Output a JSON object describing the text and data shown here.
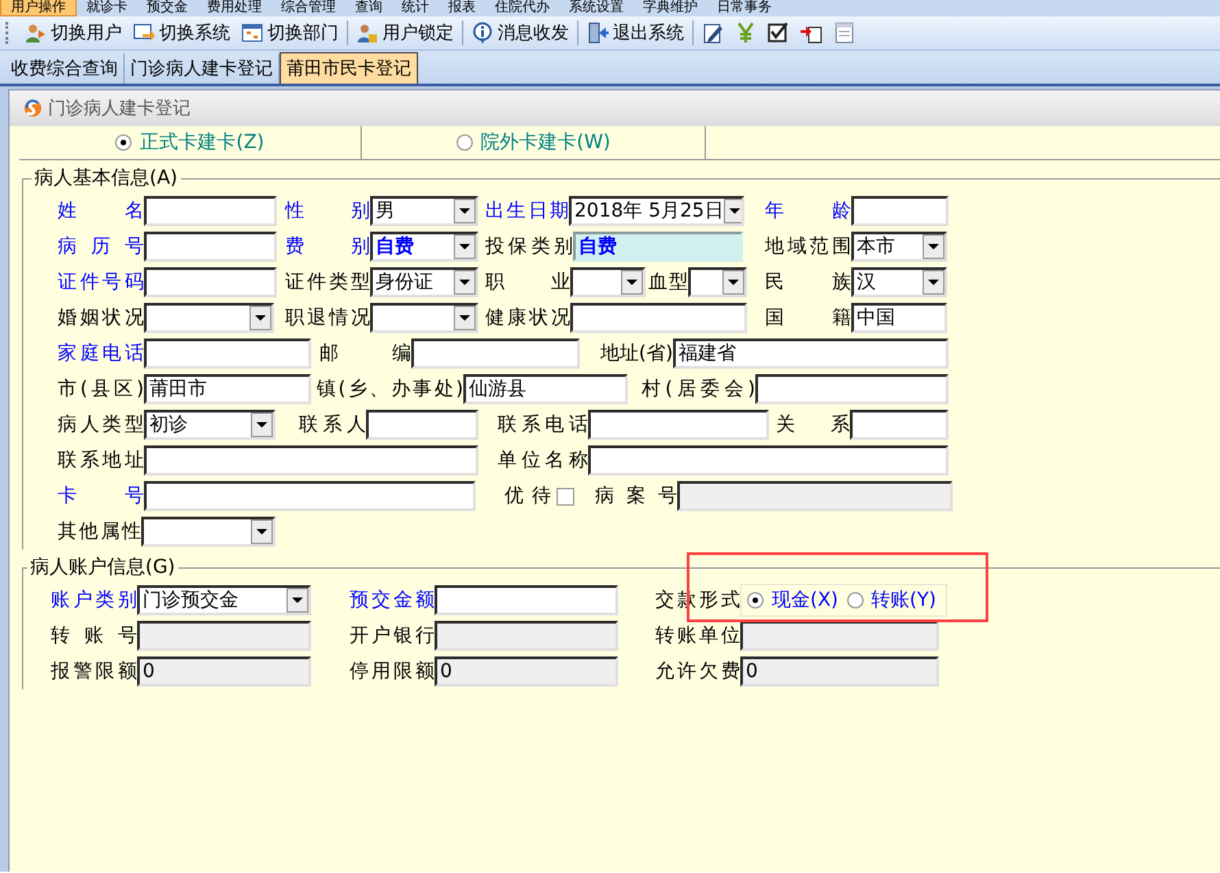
{
  "menu_bar": [
    {
      "label": "用户操作",
      "selected": true
    },
    {
      "label": "就诊卡",
      "selected": false
    },
    {
      "label": "预交金",
      "selected": false
    },
    {
      "label": "费用处理",
      "selected": false
    },
    {
      "label": "综合管理",
      "selected": false
    },
    {
      "label": "查询",
      "selected": false
    },
    {
      "label": "统计",
      "selected": false
    },
    {
      "label": "报表",
      "selected": false
    },
    {
      "label": "住院代办",
      "selected": false
    },
    {
      "label": "系统设置",
      "selected": false
    },
    {
      "label": "字典维护",
      "selected": false
    },
    {
      "label": "日常事务",
      "selected": false
    }
  ],
  "toolbar": [
    {
      "kind": "users",
      "label": "切换用户"
    },
    {
      "kind": "switch",
      "label": "切换系统"
    },
    {
      "kind": "dept",
      "label": "切换部门"
    },
    {
      "kind": "sep"
    },
    {
      "kind": "lock",
      "label": "用户锁定"
    },
    {
      "kind": "sep"
    },
    {
      "kind": "info",
      "label": "消息收发"
    },
    {
      "kind": "sep"
    },
    {
      "kind": "exit",
      "label": "退出系统"
    },
    {
      "kind": "sep"
    },
    {
      "kind": "edit"
    },
    {
      "kind": "yen"
    },
    {
      "kind": "check"
    },
    {
      "kind": "doc"
    },
    {
      "kind": "window"
    }
  ],
  "tabs": [
    {
      "label": "收费综合查询",
      "selected": false
    },
    {
      "label": "门诊病人建卡登记",
      "selected": false
    },
    {
      "label": "莆田市民卡登记",
      "selected": true
    }
  ],
  "panel": {
    "title": "门诊病人建卡登记"
  },
  "card_types": [
    {
      "label": "正式卡建卡(Z)",
      "selected": true
    },
    {
      "label": "院外卡建卡(W)",
      "selected": false
    }
  ],
  "basic_info": {
    "title": "病人基本信息(A)",
    "rows": [
      [
        {
          "label": "姓 名",
          "kind": "text",
          "required": true
        },
        {
          "label": "性 别",
          "kind": "select",
          "value": "男",
          "required": true
        },
        {
          "label": "出生日期",
          "kind": "select",
          "value": "2018年 5月25日",
          "required": true
        },
        {
          "label": "年 龄",
          "kind": "text",
          "required": true
        }
      ],
      [
        {
          "label": "病 历 号",
          "kind": "text",
          "required": true
        },
        {
          "label": "费 别",
          "kind": "select",
          "value": "自费",
          "required": true,
          "emphasis": true
        },
        {
          "label": "投保类别",
          "kind": "readonly",
          "value": "自费",
          "emphasis": true
        },
        {
          "label": "地域范围",
          "kind": "select",
          "value": "本市"
        }
      ],
      [
        {
          "label": "证件号码",
          "kind": "text",
          "required": true
        },
        {
          "label": "证件类型",
          "kind": "select",
          "value": "身份证"
        },
        {
          "label": "职 业",
          "kind": "select"
        },
        {
          "label": "血型",
          "kind": "select"
        },
        {
          "label": "民 族",
          "kind": "select",
          "value": "汉"
        }
      ],
      [
        {
          "label": "婚姻状况",
          "kind": "select"
        },
        {
          "label": "职退情况",
          "kind": "select"
        },
        {
          "label": "健康状况",
          "kind": "text"
        },
        {
          "label": "国 籍",
          "kind": "text",
          "value": "中国"
        }
      ],
      [
        {
          "label": "家庭电话",
          "kind": "text",
          "required": true
        },
        {
          "label": "邮 编",
          "kind": "text"
        },
        {
          "label": "地址(省)",
          "kind": "text",
          "value": "福建省"
        }
      ],
      [
        {
          "label": "市(县区)",
          "kind": "text",
          "value": "莆田市"
        },
        {
          "label": "镇(乡、办事处)",
          "kind": "text",
          "value": "仙游县"
        },
        {
          "label": "村(居委会)",
          "kind": "text"
        }
      ],
      [
        {
          "label": "病人类型",
          "kind": "select",
          "value": "初诊"
        },
        {
          "label": "联系人",
          "kind": "text"
        },
        {
          "label": "联系电话",
          "kind": "text"
        },
        {
          "label": "关 系",
          "kind": "text"
        }
      ],
      [
        {
          "label": "联系地址",
          "kind": "text"
        },
        {
          "label": "单位名称",
          "kind": "text"
        }
      ],
      [
        {
          "label": "卡 号",
          "kind": "text",
          "required": true
        },
        {
          "label": "优待",
          "kind": "checkbox",
          "checked": false
        },
        {
          "label": "病 案 号",
          "kind": "disabled"
        }
      ],
      [
        {
          "label": "其他属性",
          "kind": "select"
        }
      ]
    ]
  },
  "account_info": {
    "title": "病人账户信息(G)",
    "rows": [
      [
        {
          "label": "账户类别",
          "kind": "select",
          "value": "门诊预交金",
          "required": true
        },
        {
          "label": "预交金额",
          "kind": "text",
          "required": true
        },
        {
          "label": "交款形式",
          "kind": "radio",
          "options": [
            {
              "label": "现金(X)",
              "selected": true
            },
            {
              "label": "转账(Y)",
              "selected": false
            }
          ]
        }
      ],
      [
        {
          "label": "转 账 号",
          "kind": "disabled"
        },
        {
          "label": "开户银行",
          "kind": "disabled"
        },
        {
          "label": "转账单位",
          "kind": "disabled"
        }
      ],
      [
        {
          "label": "报警限额",
          "kind": "disabled",
          "value": "0"
        },
        {
          "label": "停用限额",
          "kind": "disabled",
          "value": "0"
        },
        {
          "label": "允许欠费",
          "kind": "disabled",
          "value": "0"
        }
      ]
    ]
  }
}
